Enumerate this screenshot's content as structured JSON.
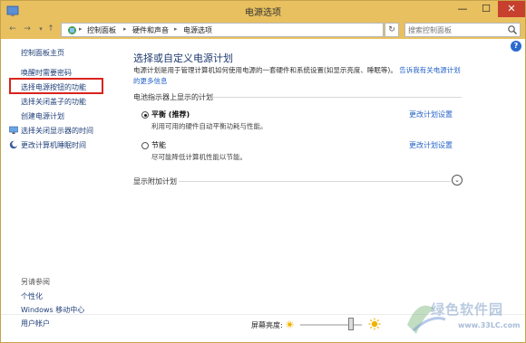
{
  "window": {
    "title": "电源选项",
    "controls": {
      "minimize": "—",
      "maximize": "☐",
      "close": "✕"
    }
  },
  "addressbar": {
    "back": "←",
    "forward": "→",
    "up": "↑",
    "breadcrumb": [
      "控制面板",
      "硬件和声音",
      "电源选项"
    ],
    "refresh": "↻",
    "search_placeholder": "搜索控制面板"
  },
  "help": {
    "label": "?"
  },
  "sidebar": {
    "home": "控制面板主页",
    "tasks": [
      {
        "label": "唤醒时需要密码"
      },
      {
        "label": "选择电源按钮的功能",
        "highlighted": true
      },
      {
        "label": "选择关闭盖子的功能"
      },
      {
        "label": "创建电源计划"
      },
      {
        "label": "选择关闭显示器的时间"
      },
      {
        "label": "更改计算机睡眠时间"
      }
    ],
    "see_also_heading": "另请参阅",
    "see_also": [
      {
        "label": "个性化"
      },
      {
        "label": "Windows 移动中心"
      },
      {
        "label": "用户帐户"
      }
    ]
  },
  "main": {
    "title": "选择或自定义电源计划",
    "description": "电源计划是用于管理计算机如何使用电源的一套硬件和系统设置(如显示亮度、睡眠等)。",
    "description_link": "告诉我有关电源计划的更多信息",
    "group_label": "电池指示器上显示的计划",
    "plans": [
      {
        "name": "平衡 (推荐)",
        "description": "利用可用的硬件自动平衡功耗与性能。",
        "selected": true,
        "edit": "更改计划设置"
      },
      {
        "name": "节能",
        "description": "尽可能降低计算机性能以节能。",
        "selected": false,
        "edit": "更改计划设置"
      }
    ],
    "more_plans": "显示附加计划"
  },
  "bottom": {
    "brightness_label": "屏幕亮度:",
    "brightness_level": 0.78
  },
  "watermark": {
    "text": "绿色软件园",
    "url": "www.33LC.com"
  },
  "colors": {
    "titlebar": "#e8c05f",
    "close": "#c7402e",
    "link": "#2462c6",
    "highlight": "#d9241c"
  }
}
